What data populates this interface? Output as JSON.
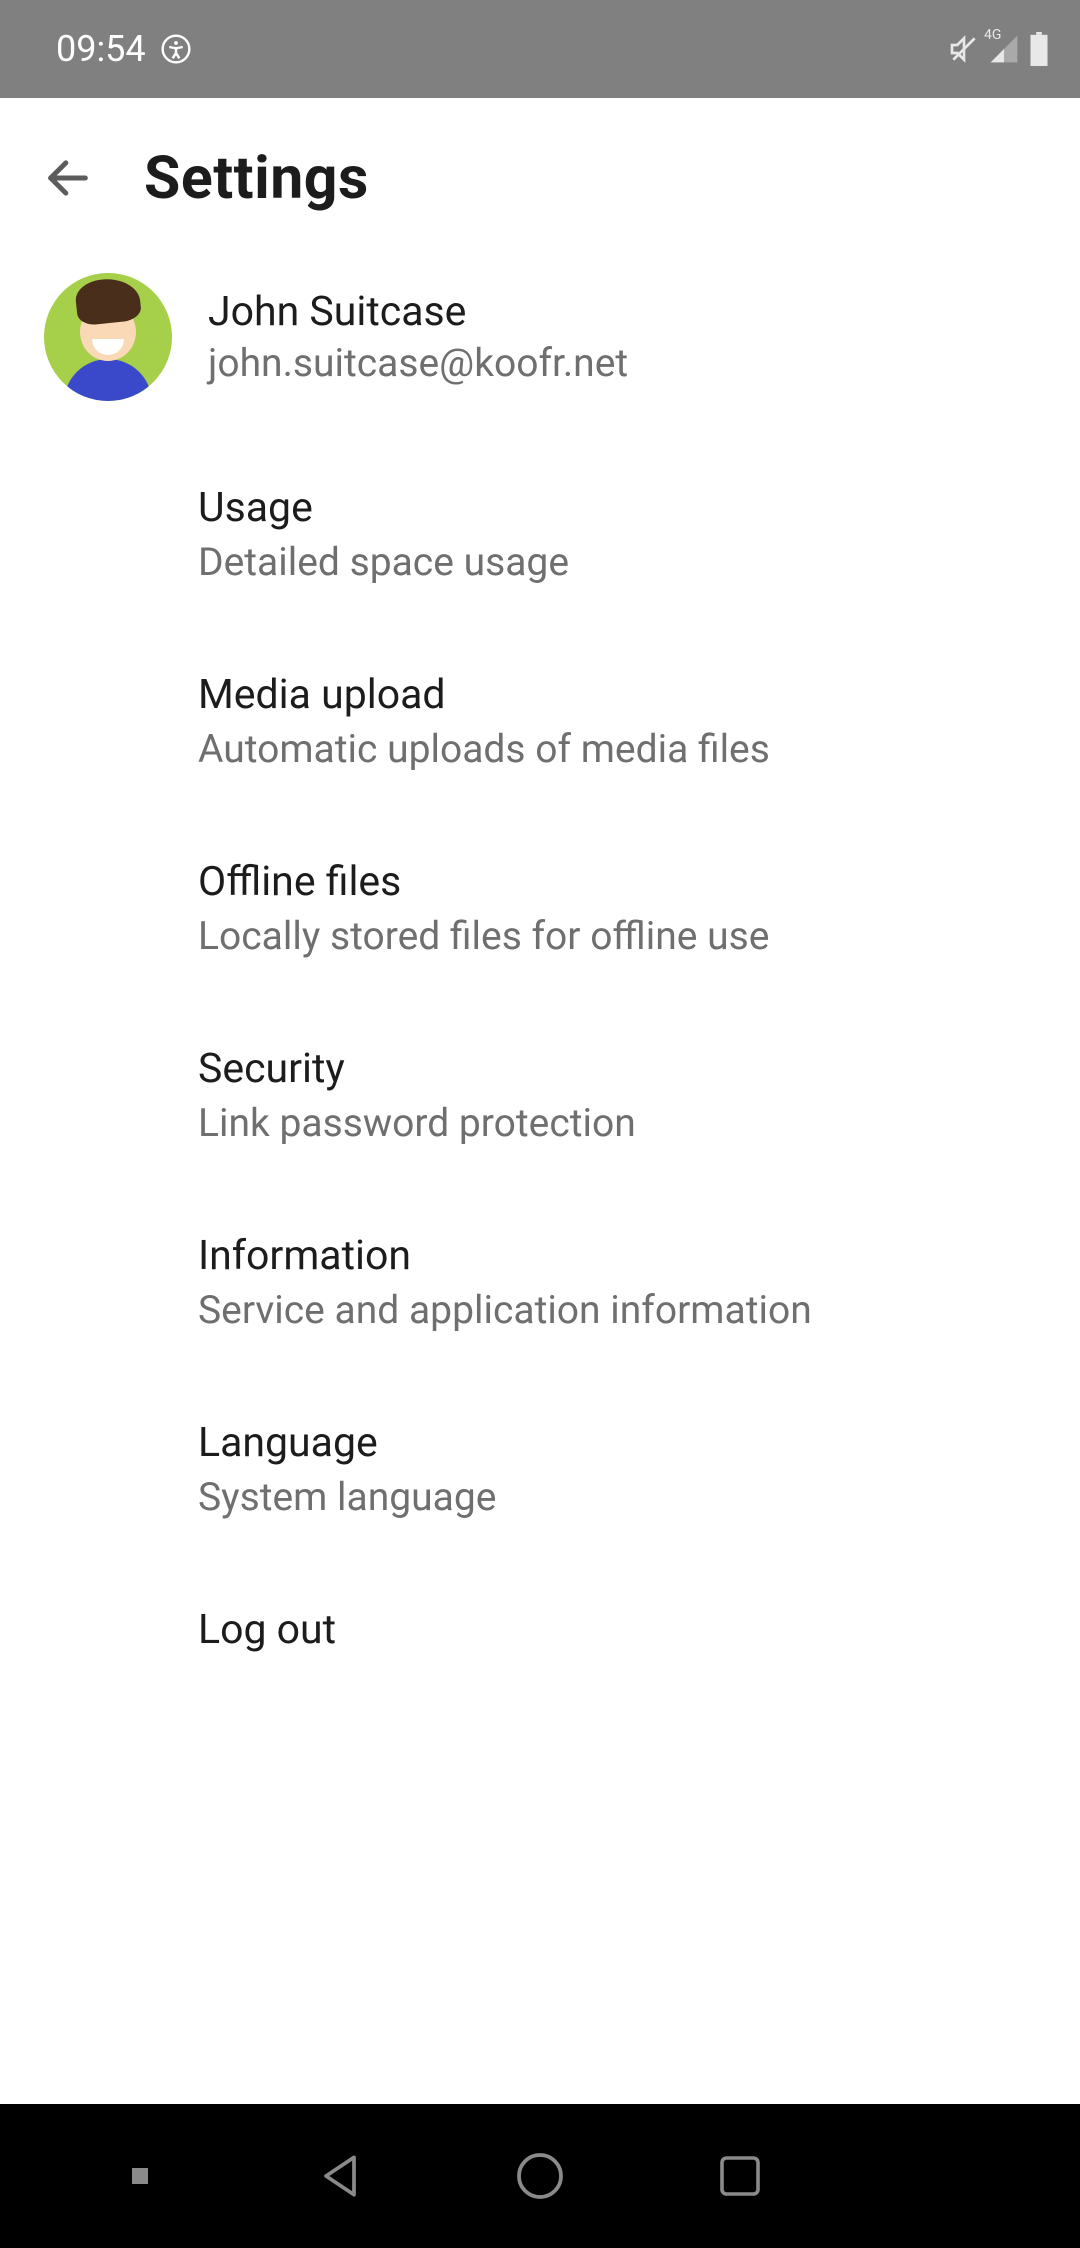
{
  "status": {
    "time": "09:54",
    "network_label": "4G"
  },
  "header": {
    "title": "Settings"
  },
  "user": {
    "name": "John Suitcase",
    "email": "john.suitcase@koofr.net"
  },
  "settings": [
    {
      "title": "Usage",
      "sub": "Detailed space usage"
    },
    {
      "title": "Media upload",
      "sub": "Automatic uploads of media files"
    },
    {
      "title": "Offline files",
      "sub": "Locally stored files for offline use"
    },
    {
      "title": "Security",
      "sub": "Link password protection"
    },
    {
      "title": "Information",
      "sub": "Service and application information"
    },
    {
      "title": "Language",
      "sub": "System language"
    },
    {
      "title": "Log out",
      "sub": ""
    }
  ]
}
